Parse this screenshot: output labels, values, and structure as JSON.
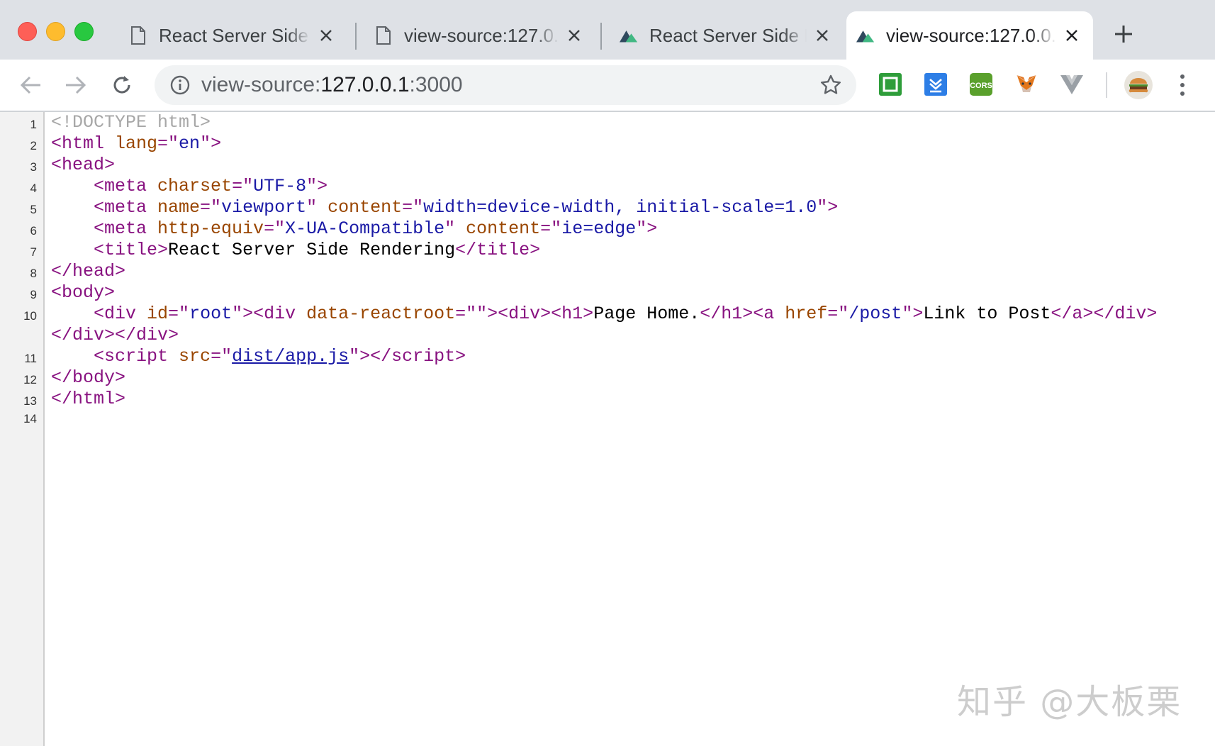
{
  "tabs": [
    {
      "title": "React Server Side Rendering",
      "icon": "document-icon",
      "active": false
    },
    {
      "title": "view-source:127.0.0.1:3000",
      "icon": "document-icon",
      "active": false
    },
    {
      "title": "React Server Side Rendering",
      "icon": "nuxt-mountain-icon",
      "active": false
    },
    {
      "title": "view-source:127.0.0.1:3000",
      "icon": "nuxt-mountain-icon",
      "active": true
    }
  ],
  "omnibox": {
    "scheme": "view-source:",
    "host": "127.0.0.1",
    "port": ":3000"
  },
  "extensions": [
    "green-square-extension-icon",
    "blue-download-extension-icon",
    "cors-extension-icon",
    "metamask-fox-icon",
    "vue-devtools-icon"
  ],
  "source": {
    "line_numbers": [
      "1",
      "2",
      "3",
      "4",
      "5",
      "6",
      "7",
      "8",
      "9",
      "10",
      "11",
      "12",
      "13",
      "14"
    ],
    "doctype": "<!DOCTYPE html>",
    "title_text": "React Server Side Rendering",
    "h1_text": "Page Home.",
    "link_text": "Link to Post",
    "href": "/post",
    "script_src": "dist/app.js",
    "lang": "en",
    "charset": "UTF-8",
    "viewport_content": "width=device-width, initial-scale=1.0",
    "http_equiv": "X-UA-Compatible",
    "compat_content": "ie=edge",
    "root_id": "root"
  },
  "watermark": "知乎 @大板栗",
  "colors": {
    "tag": "#881280",
    "attr_name": "#994500",
    "attr_value": "#1a1aa6",
    "comment": "#a7a7a7"
  }
}
